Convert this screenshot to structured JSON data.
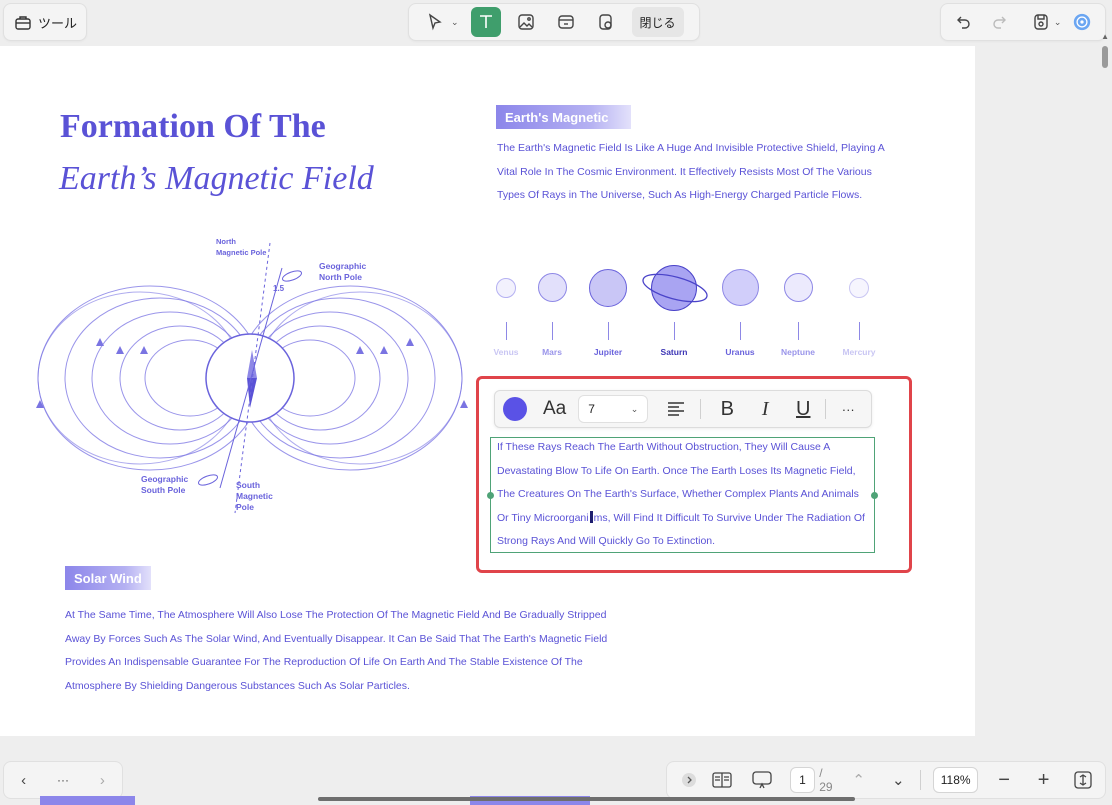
{
  "toolbar": {
    "tools_label": "ツール",
    "close_label": "閉じる"
  },
  "document": {
    "title_line1": "Formation Of The",
    "title_line2": "Earth’s Magnetic Field",
    "earth_tag": "Earth's Magnetic",
    "earth_text": "The Earth's Magnetic Field Is Like A Huge And Invisible Protective Shield, Playing A Vital Role In The Cosmic Environment. It Effectively Resists Most Of The Various Types Of Rays in The Universe, Such As High-Energy Charged Particle Flows.",
    "planets": [
      {
        "name": "Venus",
        "color": "#c9c6f3"
      },
      {
        "name": "Mars",
        "color": "#9a95ea"
      },
      {
        "name": "Jupiter",
        "color": "#6a63dc"
      },
      {
        "name": "Saturn",
        "color": "#3c35b5"
      },
      {
        "name": "Uranus",
        "color": "#6a63dc"
      },
      {
        "name": "Neptune",
        "color": "#9a95ea"
      },
      {
        "name": "Mercury",
        "color": "#c9c6f3"
      }
    ],
    "diagram_labels": {
      "north_magnetic": "North\nMagnetic Pole",
      "geo_north": "Geographic\nNorth Pole",
      "angle": "1.5",
      "geo_south": "Geographic\nSouth Pole",
      "south_magnetic": "South\nMagnetic\nPole"
    },
    "selected_text_before": "If These Rays Reach The Earth Without Obstruction, They Will Cause A Devastating Blow To Life On Earth. Once The Earth Loses Its Magnetic Field, The Creatures On The Earth's Surface, Whether Complex Plants And Animals Or Tiny Microorgani",
    "selected_text_after": "ms, Will Find It Difficult To Survive Under The Radiation Of Strong Rays And Will Quickly Go To Extinction.",
    "solar_tag": "Solar Wind",
    "solar_text": "At The Same Time, The Atmosphere Will Also Lose The Protection Of The Magnetic Field And Be Gradually Stripped Away By Forces Such As The Solar Wind, And Eventually Disappear. It Can Be Said That The Earth's Magnetic Field Provides An Indispensable Guarantee For The Reproduction Of Life On Earth And The Stable Existence Of The Atmosphere By Shielding Dangerous Substances Such As Solar Particles."
  },
  "format_bar": {
    "font_label": "Aa",
    "font_size": "7",
    "more": "···",
    "text_color": "#5a52e6"
  },
  "bottom_bar": {
    "more": "···",
    "current_page": "1",
    "total_pages": "/ 29",
    "zoom": "118%"
  },
  "colors": {
    "accent": "#5a52d6",
    "active_tool": "#3f9e6c",
    "selection_red": "#e0444a"
  }
}
